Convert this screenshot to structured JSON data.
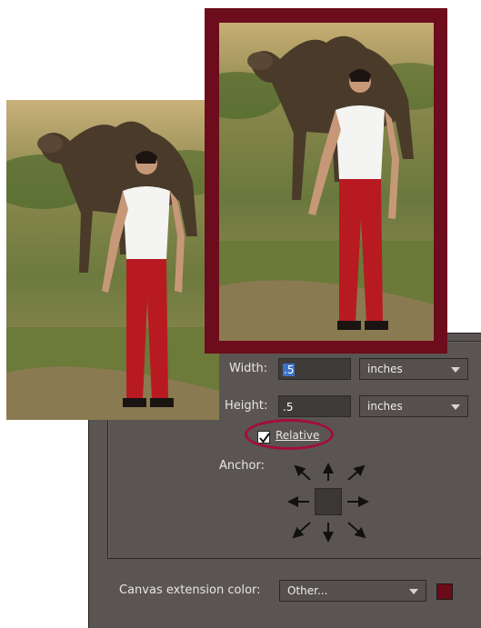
{
  "dialog": {
    "width_label": "Width:",
    "width_value": ".5",
    "width_unit": "inches",
    "height_label": "Height:",
    "height_value": ".5",
    "height_unit": "inches",
    "relative_label": "Relative",
    "relative_checked": true,
    "anchor_label": "Anchor:",
    "extension_color_label": "Canvas extension color:",
    "extension_color_value": "Other...",
    "extension_color_swatch": "#6b0a18"
  },
  "icons": {
    "anchor_arrows": [
      "arrow-up-left-icon",
      "arrow-up-icon",
      "arrow-up-right-icon",
      "arrow-left-icon",
      "arrow-right-icon",
      "arrow-down-left-icon",
      "arrow-down-icon",
      "arrow-down-right-icon"
    ],
    "checkbox": "checkmark-icon",
    "dropdown": "chevron-down-icon"
  },
  "colors": {
    "frame": "#6d0c1c",
    "highlight": "#a30d3c",
    "panel": "#5a5552"
  }
}
